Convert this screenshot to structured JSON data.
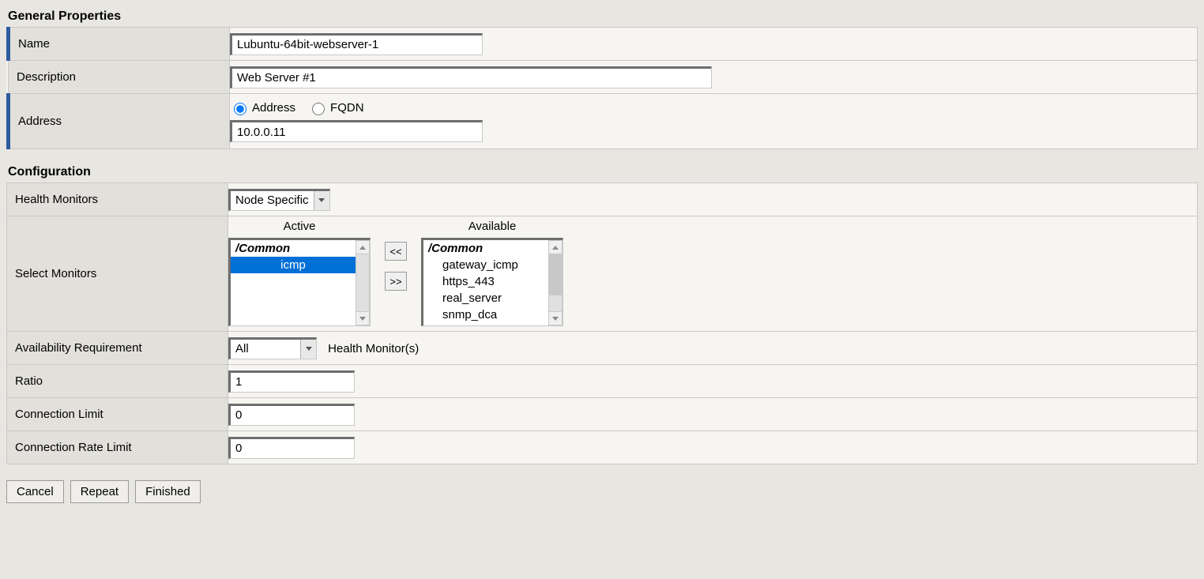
{
  "sections": {
    "general": {
      "title": "General Properties",
      "name_label": "Name",
      "name_value": "Lubuntu-64bit-webserver-1",
      "description_label": "Description",
      "description_value": "Web Server #1",
      "address_label": "Address",
      "address_radio_address": "Address",
      "address_radio_fqdn": "FQDN",
      "address_value": "10.0.0.11"
    },
    "configuration": {
      "title": "Configuration",
      "health_monitors_label": "Health Monitors",
      "health_monitors_value": "Node Specific",
      "select_monitors_label": "Select Monitors",
      "active_header": "Active",
      "available_header": "Available",
      "group_label": "/Common",
      "active_items": [
        "icmp"
      ],
      "available_items": [
        "gateway_icmp",
        "https_443",
        "real_server",
        "snmp_dca"
      ],
      "move_left": "<<",
      "move_right": ">>",
      "availability_label": "Availability Requirement",
      "availability_value": "All",
      "availability_suffix": "Health Monitor(s)",
      "ratio_label": "Ratio",
      "ratio_value": "1",
      "conn_limit_label": "Connection Limit",
      "conn_limit_value": "0",
      "conn_rate_limit_label": "Connection Rate Limit",
      "conn_rate_limit_value": "0"
    }
  },
  "buttons": {
    "cancel": "Cancel",
    "repeat": "Repeat",
    "finished": "Finished"
  }
}
